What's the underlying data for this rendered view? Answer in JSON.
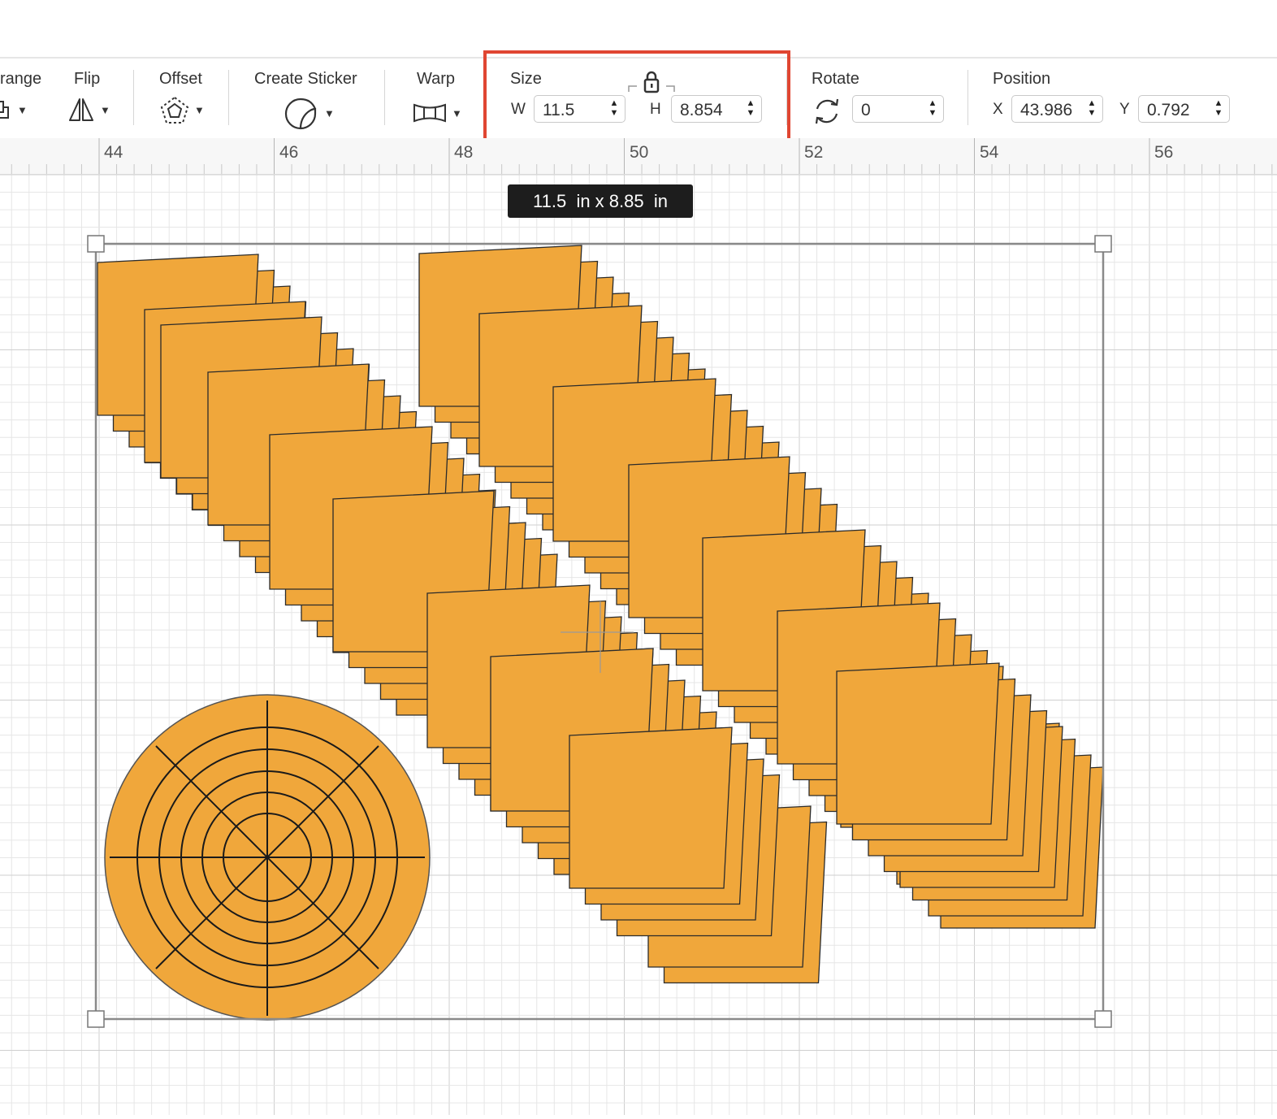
{
  "toolbar": {
    "arrange_label": "range",
    "flip_label": "Flip",
    "offset_label": "Offset",
    "create_sticker_label": "Create Sticker",
    "warp_label": "Warp",
    "size": {
      "label": "Size",
      "w_label": "W",
      "w_value": "11.5",
      "h_label": "H",
      "h_value": "8.854",
      "locked": true
    },
    "rotate": {
      "label": "Rotate",
      "value": "0"
    },
    "position": {
      "label": "Position",
      "x_label": "X",
      "x_value": "43.986",
      "y_label": "Y",
      "y_value": "0.792"
    }
  },
  "ruler": {
    "labels": [
      "44",
      "46",
      "48",
      "50",
      "52",
      "54",
      "56"
    ]
  },
  "canvas": {
    "tooltip": "11.5  in x 8.85  in",
    "shape_fill": "#f0a73b",
    "highlight_color": "#e04632"
  }
}
